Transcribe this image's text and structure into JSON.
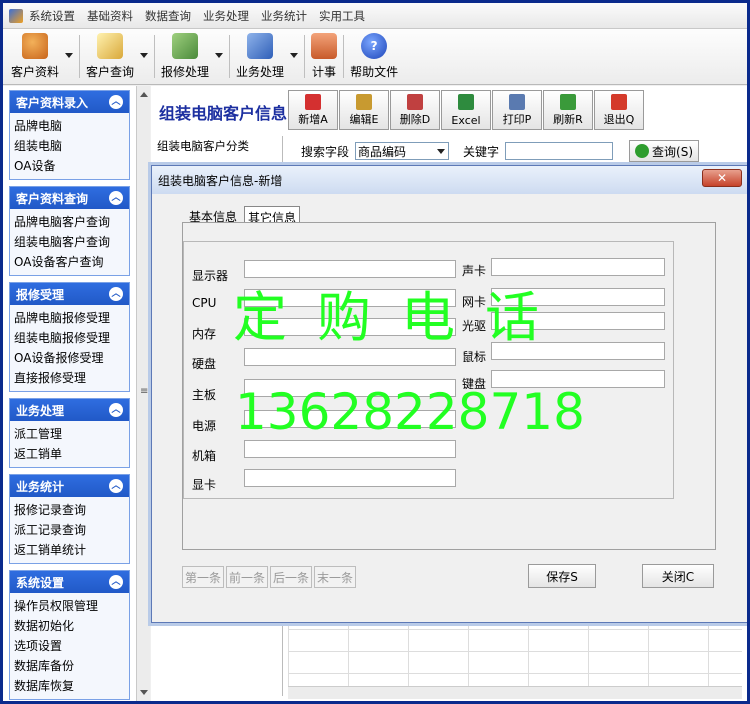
{
  "menu": [
    "系统设置",
    "基础资料",
    "数据查询",
    "业务处理",
    "业务统计",
    "实用工具"
  ],
  "toolbar": [
    {
      "label": "客户资料",
      "icon": "people-icon",
      "dropdown": true,
      "color": "#e08a2a"
    },
    {
      "label": "客户查询",
      "icon": "query-icon",
      "dropdown": true,
      "color": "#e3c35a"
    },
    {
      "label": "报修处理",
      "icon": "repair-icon",
      "dropdown": true,
      "color": "#6aa04a"
    },
    {
      "label": "业务处理",
      "icon": "business-icon",
      "dropdown": true,
      "color": "#4a78c8"
    },
    {
      "label": "计事",
      "icon": "home-icon",
      "dropdown": false,
      "color": "#d86a3a"
    },
    {
      "label": "帮助文件",
      "icon": "help-icon",
      "dropdown": false,
      "color": "#2a5ad6"
    }
  ],
  "nav": [
    {
      "title": "客户资料录入",
      "items": [
        "品牌电脑",
        "组装电脑",
        "OA设备"
      ]
    },
    {
      "title": "客户资料查询",
      "items": [
        "品牌电脑客户查询",
        "组装电脑客户查询",
        "OA设备客户查询"
      ]
    },
    {
      "title": "报修受理",
      "items": [
        "品牌电脑报修受理",
        "组装电脑报修受理",
        "OA设备报修受理",
        "直接报修受理"
      ]
    },
    {
      "title": "业务处理",
      "items": [
        "派工管理",
        "返工销单"
      ]
    },
    {
      "title": "业务统计",
      "items": [
        "报修记录查询",
        "派工记录查询",
        "返工销单统计"
      ]
    },
    {
      "title": "系统设置",
      "items": [
        "操作员权限管理",
        "数据初始化",
        "选项设置",
        "数据库备份",
        "数据库恢复"
      ]
    }
  ],
  "main": {
    "title": "组装电脑客户信息",
    "tree_node": "组装电脑客户分类",
    "buttons": [
      {
        "label": "新增A",
        "icon": "add-icon",
        "color": "#d43030"
      },
      {
        "label": "编辑E",
        "icon": "edit-icon",
        "color": "#c89a30"
      },
      {
        "label": "删除D",
        "icon": "delete-icon",
        "color": "#c04040"
      },
      {
        "label": "Excel",
        "icon": "excel-icon",
        "color": "#2e8b3e"
      },
      {
        "label": "打印P",
        "icon": "print-icon",
        "color": "#5a7ab0"
      },
      {
        "label": "刷新R",
        "icon": "refresh-icon",
        "color": "#3a9a3a"
      },
      {
        "label": "退出Q",
        "icon": "exit-icon",
        "color": "#d43a2a"
      }
    ],
    "search_label": "搜索字段",
    "search_field": "商品编码",
    "keyword_label": "关键字",
    "keyword_value": "",
    "query_button": "查询(S)"
  },
  "dialog": {
    "title": "组装电脑客户信息-新增",
    "close": "✕",
    "tabs": [
      "基本信息",
      "其它信息"
    ],
    "active_tab": 1,
    "left_fields": [
      {
        "label": "显示器",
        "value": ""
      },
      {
        "label": "CPU",
        "value": ""
      },
      {
        "label": "内存",
        "value": ""
      },
      {
        "label": "硬盘",
        "value": ""
      },
      {
        "label": "主板",
        "value": ""
      },
      {
        "label": "电源",
        "value": ""
      },
      {
        "label": "机箱",
        "value": ""
      },
      {
        "label": "显卡",
        "value": ""
      }
    ],
    "right_fields": [
      {
        "label": "声卡",
        "value": ""
      },
      {
        "label": "网卡",
        "value": ""
      },
      {
        "label": "光驱",
        "value": ""
      },
      {
        "label": "鼠标",
        "value": ""
      },
      {
        "label": "键盘",
        "value": ""
      }
    ],
    "nav_buttons": [
      "第一条",
      "前一条",
      "后一条",
      "末一条"
    ],
    "save_button": "保存S",
    "close_button": "关闭C"
  },
  "watermark": {
    "text1": "定购电话",
    "text2": "13628228718",
    "color": "#22ff22"
  }
}
